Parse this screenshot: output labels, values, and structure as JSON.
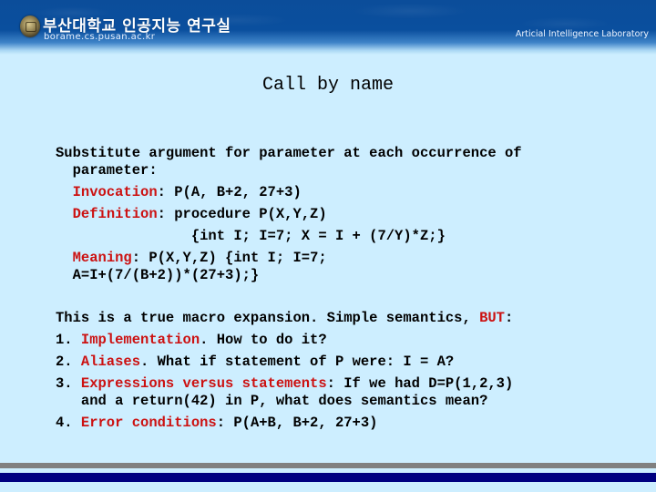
{
  "header": {
    "university_name": "부산대학교 인공지능 연구실",
    "url": "borame.cs.pusan.ac.kr",
    "lab_name": "Articial Intelligence Laboratory",
    "emblem_icon": "university-emblem"
  },
  "slide": {
    "title": "Call by name",
    "lines": [
      {
        "parts": [
          {
            "text": "Substitute argument for parameter at each occurrence of"
          }
        ]
      },
      {
        "parts": [
          {
            "text": "  parameter:"
          }
        ]
      },
      {
        "parts": [
          {
            "text": "  "
          },
          {
            "text": "Invocation",
            "highlight": true
          },
          {
            "text": ": P(A, B+2, 27+3)"
          }
        ]
      },
      {
        "parts": [
          {
            "text": "  "
          },
          {
            "text": "Definition",
            "highlight": true
          },
          {
            "text": ": procedure P(X,Y,Z)"
          }
        ]
      },
      {
        "parts": [
          {
            "text": "                {int I; I=7; X = I + (7/Y)*Z;}"
          }
        ]
      },
      {
        "parts": [
          {
            "text": "  "
          },
          {
            "text": "Meaning",
            "highlight": true
          },
          {
            "text": ": P(X,Y,Z) {int I; I=7;"
          }
        ]
      },
      {
        "parts": [
          {
            "text": "  A=I+(7/(B+2))*(27+3);}"
          }
        ]
      },
      {
        "parts": [
          {
            "text": "This is a true macro expansion. Simple semantics, "
          },
          {
            "text": "BUT",
            "highlight": true
          },
          {
            "text": ":"
          }
        ]
      },
      {
        "parts": [
          {
            "text": "1. "
          },
          {
            "text": "Implementation",
            "highlight": true
          },
          {
            "text": ". How to do it?"
          }
        ]
      },
      {
        "parts": [
          {
            "text": "2. "
          },
          {
            "text": "Aliases",
            "highlight": true
          },
          {
            "text": ". What if statement of P were: I = A?"
          }
        ]
      },
      {
        "parts": [
          {
            "text": "3. "
          },
          {
            "text": "Expressions versus statements",
            "highlight": true
          },
          {
            "text": ": If we had D=P(1,2,3)"
          }
        ]
      },
      {
        "parts": [
          {
            "text": "   and a return(42) in P, what does semantics mean?"
          }
        ]
      },
      {
        "parts": [
          {
            "text": "4. "
          },
          {
            "text": "Error conditions",
            "highlight": true
          },
          {
            "text": ": P(A+B, B+2, 27+3)"
          }
        ]
      }
    ]
  },
  "colors": {
    "background": "#cdeeff",
    "highlight": "#cc1111",
    "header_blue": "#0a4f9e",
    "footer_gray": "#808080",
    "footer_navy": "#000080"
  }
}
